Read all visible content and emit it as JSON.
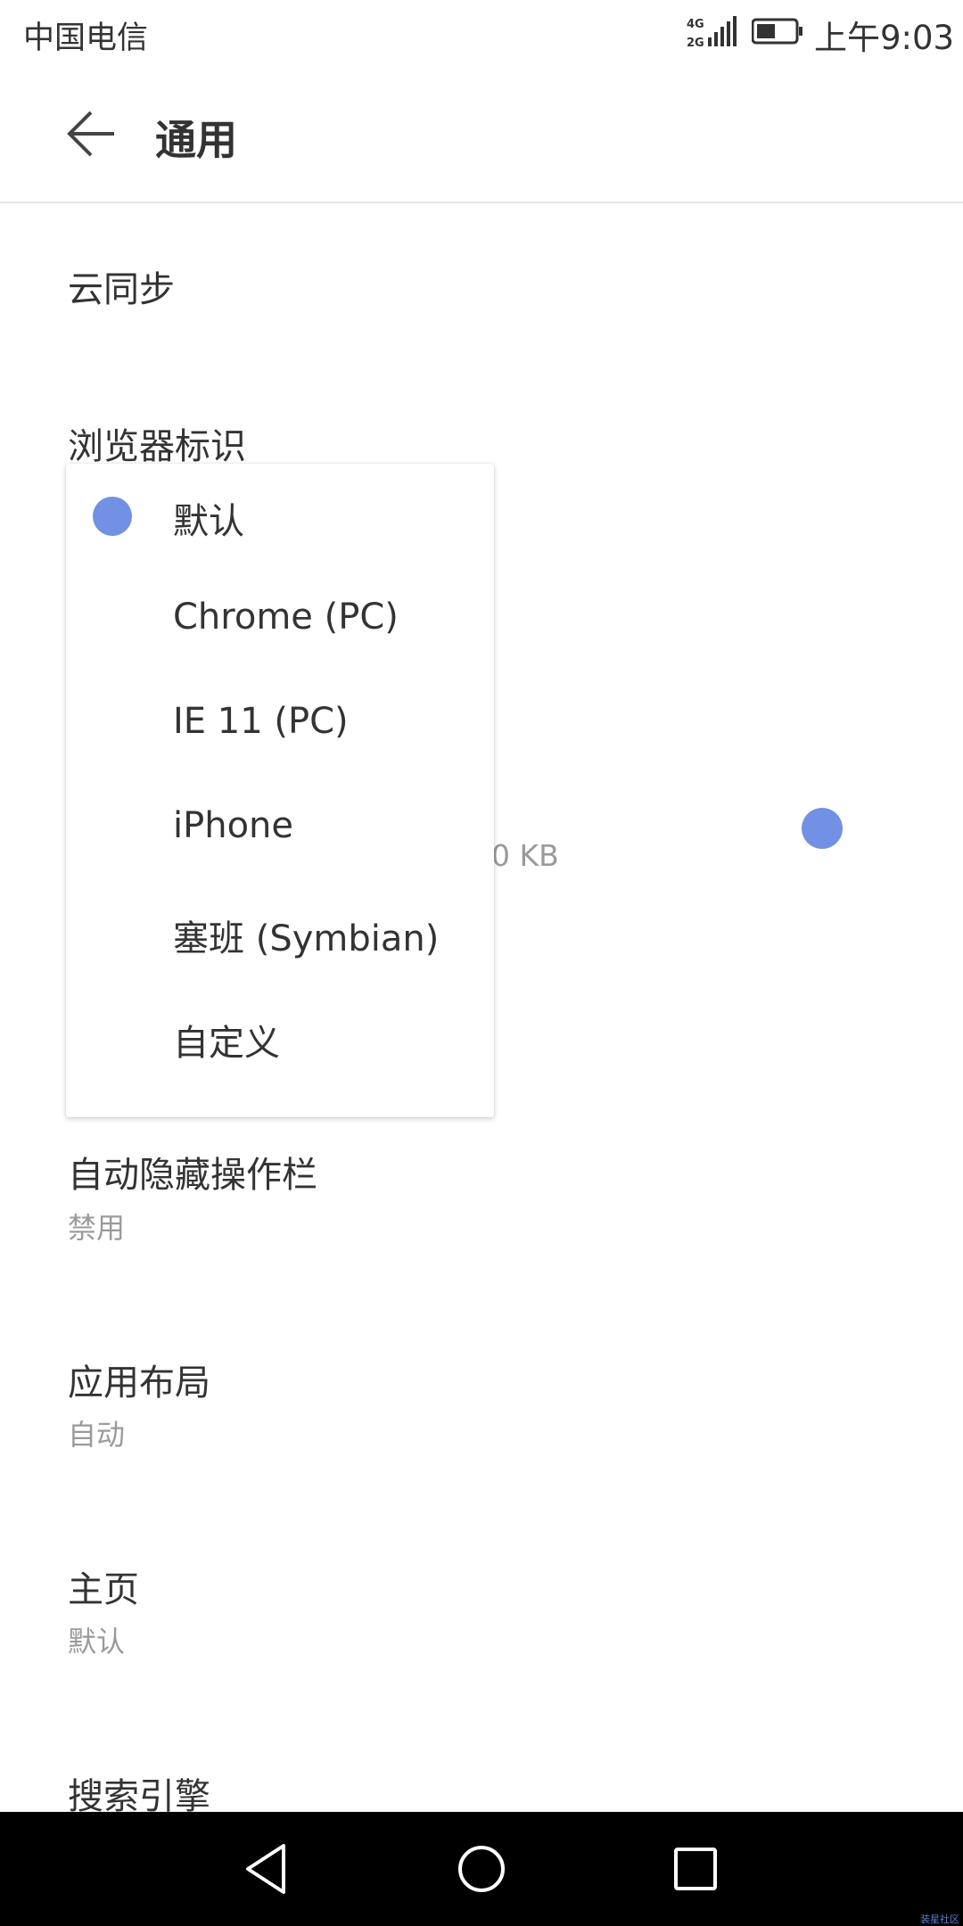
{
  "status_bar": {
    "carrier": "中国电信",
    "time": "上午9:03",
    "network_label": "4G 2G"
  },
  "app_bar": {
    "title": "通用",
    "back_icon": "arrow-left-icon"
  },
  "settings": {
    "cloud_sync": "云同步",
    "browser_ua": "浏览器标识",
    "hidden_value_fragment": "0 KB",
    "auto_hide_toolbar": {
      "title": "自动隐藏操作栏",
      "value": "禁用"
    },
    "app_layout": {
      "title": "应用布局",
      "value": "自动"
    },
    "home_page": {
      "title": "主页",
      "value": "默认"
    },
    "search_engine": "搜索引擎"
  },
  "ua_dialog": {
    "options": [
      "默认",
      "Chrome (PC)",
      "IE 11 (PC)",
      "iPhone",
      "塞班 (Symbian)",
      "自定义"
    ],
    "selected": "默认"
  },
  "nav_bar": {
    "back": "triangle-back-icon",
    "home": "circle-home-icon",
    "recents": "square-recents-icon"
  },
  "watermark": "装星社区",
  "colors": {
    "accent": "#7291e4",
    "text": "#333333",
    "secondary": "#9a9a9a"
  }
}
